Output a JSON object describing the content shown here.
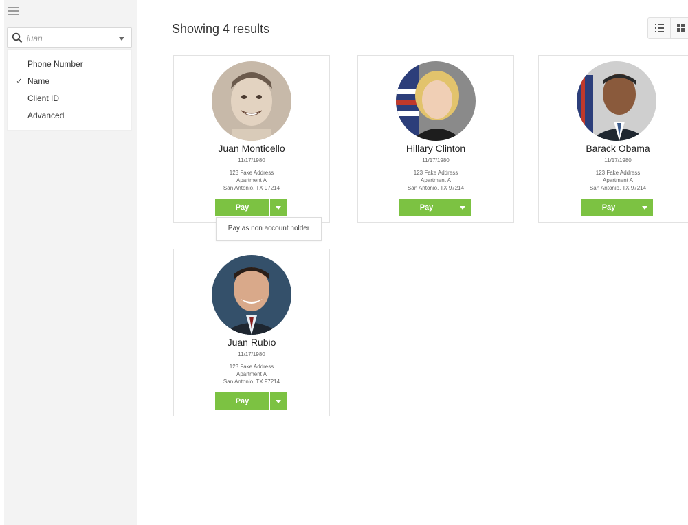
{
  "search": {
    "value": "juan",
    "placeholder": "Search"
  },
  "search_menu": [
    {
      "label": "Phone Number",
      "checked": false
    },
    {
      "label": "Name",
      "checked": true
    },
    {
      "label": "Client ID",
      "checked": false
    },
    {
      "label": "Advanced",
      "checked": false
    }
  ],
  "results_title": "Showing 4 results",
  "clients": [
    {
      "name": "Juan Monticello",
      "dob": "11/17/1980",
      "address1": "123 Fake Address",
      "address2": "Apartment A",
      "address3": "San Antonio, TX 97214",
      "pay_label": "Pay"
    },
    {
      "name": "Hillary Clinton",
      "dob": "11/17/1980",
      "address1": "123 Fake Address",
      "address2": "Apartment A",
      "address3": "San Antonio, TX 97214",
      "pay_label": "Pay"
    },
    {
      "name": "Barack Obama",
      "dob": "11/17/1980",
      "address1": "123 Fake Address",
      "address2": "Apartment A",
      "address3": "San Antonio, TX 97214",
      "pay_label": "Pay"
    },
    {
      "name": "Juan Rubio",
      "dob": "11/17/1980",
      "address1": "123 Fake Address",
      "address2": "Apartment A",
      "address3": "San Antonio, TX 97214",
      "pay_label": "Pay"
    }
  ],
  "pay_dropdown_option": "Pay as non account holder",
  "icons": {
    "menu": "hamburger-icon",
    "search": "search-icon",
    "list_view": "list-view-icon",
    "grid_view": "grid-view-icon",
    "check": "checkmark-icon",
    "dropdown": "chevron-down-icon"
  },
  "colors": {
    "pay": "#7cc242",
    "sidebar": "#f3f3f3"
  }
}
